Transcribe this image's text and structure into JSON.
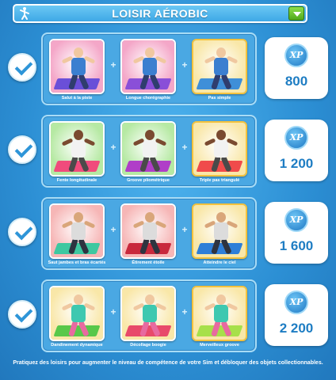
{
  "header": {
    "title": "LOISIR AÉROBIC",
    "icon": "aerobics-figure-icon",
    "dropdown_icon": "chevron-down-icon"
  },
  "rows": [
    {
      "completed": true,
      "xp": "800",
      "moves": [
        {
          "label": "Salut à la piste",
          "bg": "#f4a7c8",
          "mat": "#6a4fd8",
          "shirt": "#3b7fd0",
          "pants": "#2f3d6e",
          "skin": "#f0c8a0",
          "gold": false
        },
        {
          "label": "Longue chorégraphie",
          "bg": "#f4a7c8",
          "mat": "#8a4fd8",
          "shirt": "#3b7fd0",
          "pants": "#2f3d6e",
          "skin": "#f0c8a0",
          "gold": false
        },
        {
          "label": "Pas simple",
          "bg": "#f9e7a8",
          "mat": "#3f8fd8",
          "shirt": "#3b7fd0",
          "pants": "#2f3d6e",
          "skin": "#f0c8a0",
          "gold": true
        }
      ]
    },
    {
      "completed": true,
      "xp": "1 200",
      "moves": [
        {
          "label": "Fente longitudinale",
          "bg": "#b6e9a3",
          "mat": "#f04b7c",
          "shirt": "#f2f2f2",
          "pants": "#4a4a4a",
          "skin": "#7a4a30",
          "gold": false
        },
        {
          "label": "Groove pliométrique",
          "bg": "#b6e9a3",
          "mat": "#b03ec8",
          "shirt": "#f2f2f2",
          "pants": "#4a4a4a",
          "skin": "#7a4a30",
          "gold": false
        },
        {
          "label": "Triple pas triangulé",
          "bg": "#f9e7a8",
          "mat": "#f04b4b",
          "shirt": "#f2f2f2",
          "pants": "#4a4a4a",
          "skin": "#7a4a30",
          "gold": true
        }
      ]
    },
    {
      "completed": true,
      "xp": "1 600",
      "moves": [
        {
          "label": "Saut jambes et bras écartés",
          "bg": "#f6b6b6",
          "mat": "#3ec8a0",
          "shirt": "#dcdcdc",
          "pants": "#2e3440",
          "skin": "#d9a67a",
          "gold": false
        },
        {
          "label": "Étirement étoile",
          "bg": "#f6b6b6",
          "mat": "#c8283c",
          "shirt": "#dcdcdc",
          "pants": "#2e3440",
          "skin": "#d9a67a",
          "gold": false
        },
        {
          "label": "Atteindre le ciel",
          "bg": "#f9e7a8",
          "mat": "#2e7fd8",
          "shirt": "#dcdcdc",
          "pants": "#2e3440",
          "skin": "#d9a67a",
          "gold": true
        }
      ]
    },
    {
      "completed": true,
      "xp": "2 200",
      "moves": [
        {
          "label": "Dandinement dynamique",
          "bg": "#f9e7a8",
          "mat": "#58c84a",
          "shirt": "#3ec8b0",
          "pants": "#e86aa0",
          "skin": "#f0c8a0",
          "gold": false
        },
        {
          "label": "Décollage boogie",
          "bg": "#f9e7a8",
          "mat": "#e84a6a",
          "shirt": "#3ec8b0",
          "pants": "#e86aa0",
          "skin": "#f0c8a0",
          "gold": false
        },
        {
          "label": "Merveilleux groove",
          "bg": "#f9e7a8",
          "mat": "#a7e04a",
          "shirt": "#3ec8b0",
          "pants": "#e86aa0",
          "skin": "#f0c8a0",
          "gold": true
        }
      ]
    }
  ],
  "footer": {
    "text": "Pratiquez des loisirs pour augmenter le niveau de compétence de votre Sim et débloquer des objets collectionnables."
  },
  "xp_badge_text": "XP"
}
